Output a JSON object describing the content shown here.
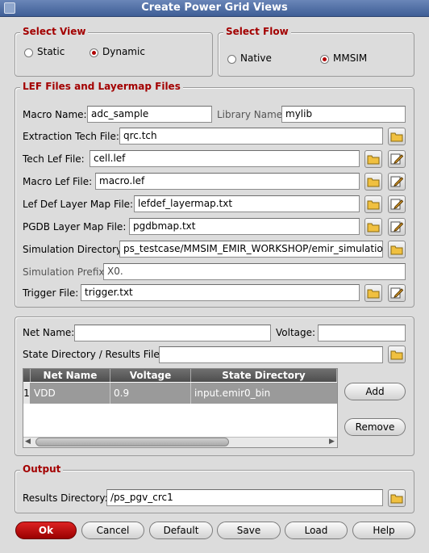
{
  "window": {
    "title": "Create Power Grid Views"
  },
  "select_view": {
    "title": "Select View",
    "options": [
      {
        "label": "Static",
        "selected": false
      },
      {
        "label": "Dynamic",
        "selected": true
      }
    ]
  },
  "select_flow": {
    "title": "Select Flow",
    "options": [
      {
        "label": "Native",
        "selected": false
      },
      {
        "label": "MMSIM",
        "selected": true
      }
    ]
  },
  "lef": {
    "title": "LEF Files and Layermap Files",
    "macro_name_label": "Macro Name:",
    "macro_name_value": "adc_sample",
    "library_name_label": "Library Name",
    "library_name_value": "mylib",
    "extraction_label": "Extraction Tech File:",
    "extraction_value": "qrc.tch",
    "tech_lef_label": "Tech Lef File:",
    "tech_lef_value": "cell.lef",
    "macro_lef_label": "Macro Lef File:",
    "macro_lef_value": "macro.lef",
    "lefdef_label": "Lef Def Layer Map File:",
    "lefdef_value": "lefdef_layermap.txt",
    "pgdb_label": "PGDB Layer Map File:",
    "pgdb_value": "pgdbmap.txt",
    "sim_dir_label": "Simulation Directory:",
    "sim_dir_value": "ps_testcase/MMSIM_EMIR_WORKSHOP/emir_simulation",
    "sim_prefix_label": "Simulation Prefix:",
    "sim_prefix_value": "X0.",
    "trigger_label": "Trigger File:",
    "trigger_value": "trigger.txt"
  },
  "net": {
    "net_name_label": "Net Name:",
    "net_name_value": "",
    "voltage_label": "Voltage:",
    "voltage_value": "",
    "state_dir_label": "State Directory / Results File:",
    "state_dir_value": "",
    "table": {
      "columns": [
        "Net Name",
        "Voltage",
        "State Directory"
      ],
      "rows": [
        {
          "index": "1",
          "net": "VDD",
          "voltage": "0.9",
          "state": "input.emir0_bin"
        }
      ]
    },
    "add_label": "Add",
    "remove_label": "Remove"
  },
  "output": {
    "title": "Output",
    "results_label": "Results Directory:",
    "results_value": "/ps_pgv_crc1"
  },
  "buttons": {
    "ok": "Ok",
    "cancel": "Cancel",
    "default": "Default",
    "save": "Save",
    "load": "Load",
    "help": "Help"
  },
  "icons": {
    "folder": "folder-icon",
    "edit": "edit-icon"
  },
  "colors": {
    "accent": "#a30000",
    "ok_button": "#c00000",
    "selected_row": "#9a9a9a"
  }
}
